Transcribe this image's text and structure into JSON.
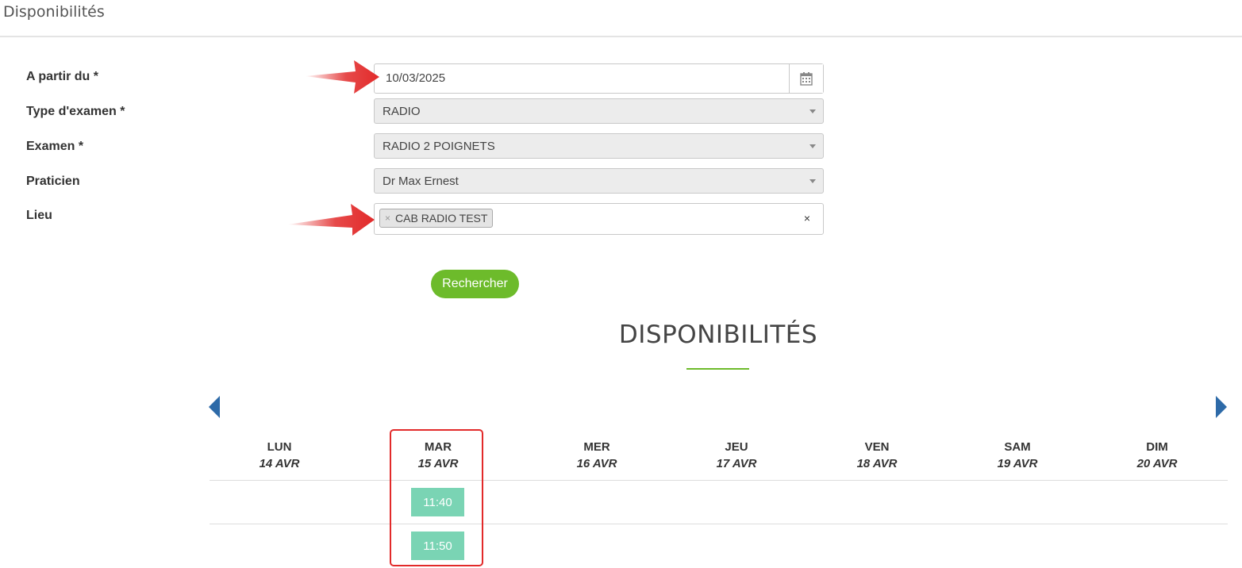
{
  "page": {
    "title": "Disponibilités"
  },
  "form": {
    "date": {
      "label": "A partir du *",
      "value": "10/03/2025",
      "icon": "calendar-icon"
    },
    "exam_type": {
      "label": "Type d'examen *",
      "value": "RADIO"
    },
    "exam": {
      "label": "Examen *",
      "value": "RADIO 2 POIGNETS"
    },
    "practitioner": {
      "label": "Praticien",
      "value": "Dr Max Ernest"
    },
    "location": {
      "label": "Lieu",
      "tags": [
        {
          "remove": "×",
          "label": "CAB RADIO TEST"
        }
      ],
      "clear": "×"
    },
    "search_button": "Rechercher"
  },
  "availability": {
    "title": "DISPONIBILITÉS",
    "days": [
      {
        "name": "LUN",
        "date": "14 AVR"
      },
      {
        "name": "MAR",
        "date": "15 AVR"
      },
      {
        "name": "MER",
        "date": "16 AVR"
      },
      {
        "name": "JEU",
        "date": "17 AVR"
      },
      {
        "name": "VEN",
        "date": "18 AVR"
      },
      {
        "name": "SAM",
        "date": "19 AVR"
      },
      {
        "name": "DIM",
        "date": "20 AVR"
      }
    ],
    "slots": [
      {
        "day": "MAR",
        "time": "11:40"
      },
      {
        "day": "MAR",
        "time": "11:50"
      }
    ]
  },
  "colors": {
    "accent_green": "#6dbb2b",
    "slot_green": "#7ad4b4",
    "nav_blue": "#2d6aa8",
    "annotation_red": "#e22a2a"
  }
}
